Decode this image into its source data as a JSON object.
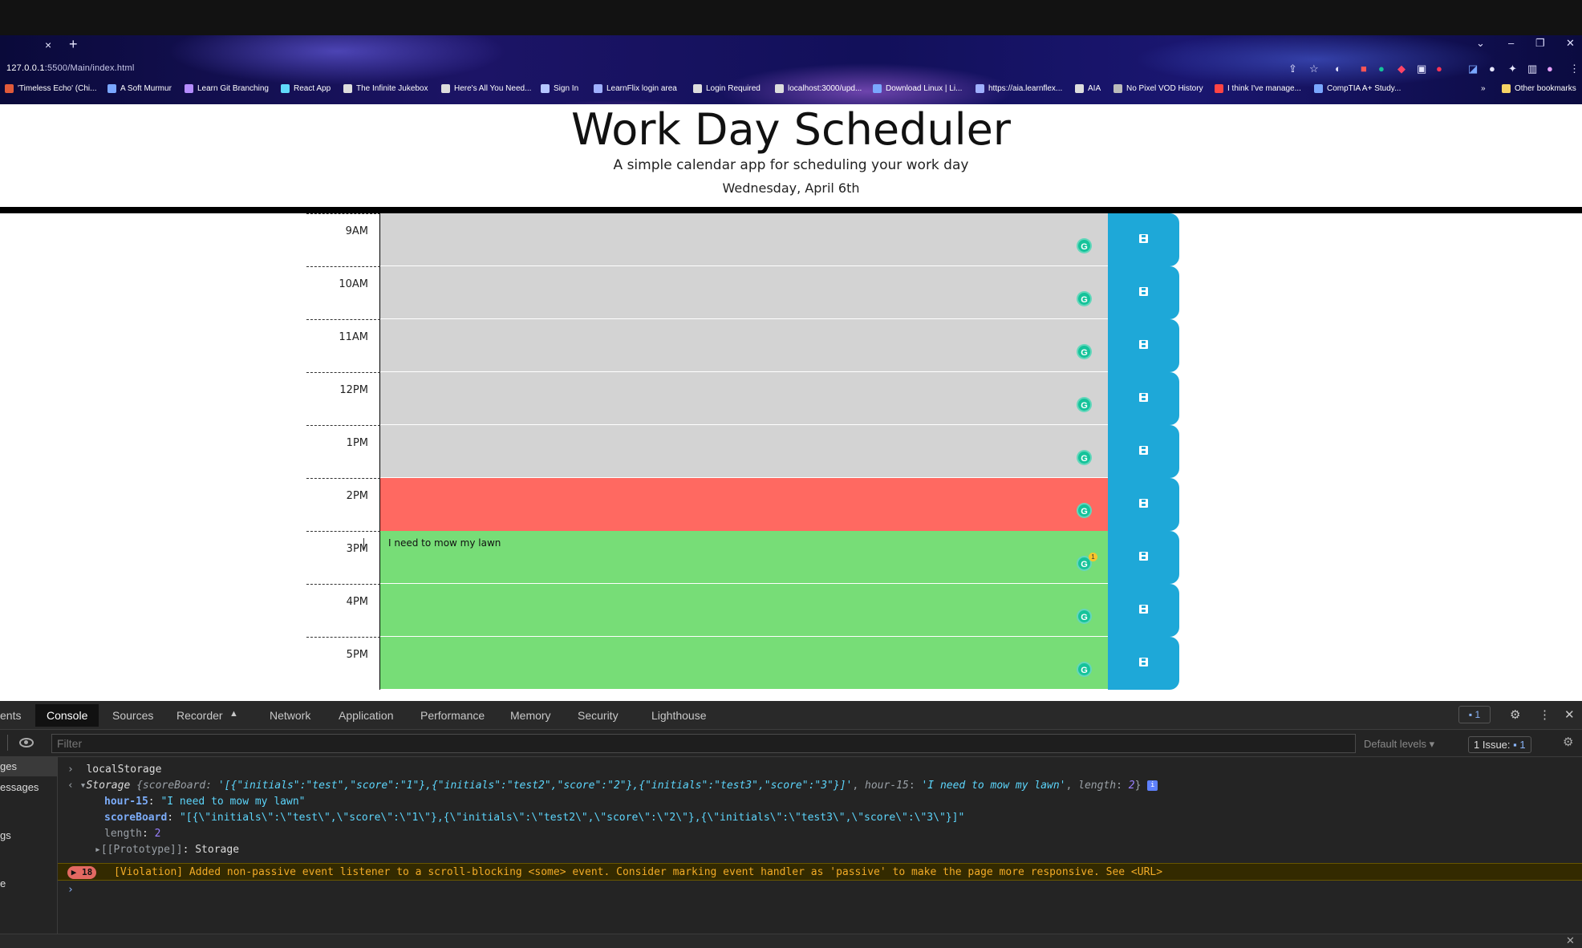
{
  "browser": {
    "tab_close": "×",
    "new_tab": "+",
    "url_host": "127.0.0.1",
    "url_rest": ":5500/Main/index.html",
    "bookmarks": [
      {
        "label": "'Timeless Echo' (Chi...",
        "color": "#e05a3a"
      },
      {
        "label": "A Soft Murmur",
        "color": "#7aa7ff"
      },
      {
        "label": "Learn Git Branching",
        "color": "#b58cff"
      },
      {
        "label": "React App",
        "color": "#61dafb"
      },
      {
        "label": "The Infinite Jukebox",
        "color": "#dddddd"
      },
      {
        "label": "Here's All You Need...",
        "color": "#dddddd"
      },
      {
        "label": "Sign In",
        "color": "#b6c6ff"
      },
      {
        "label": "LearnFlix login area",
        "color": "#9fb0ff"
      },
      {
        "label": "Login Required",
        "color": "#dddddd"
      },
      {
        "label": "localhost:3000/upd...",
        "color": "#dddddd"
      },
      {
        "label": "Download Linux | Li...",
        "color": "#7aa7ff"
      },
      {
        "label": "https://aia.learnflex...",
        "color": "#9fb0ff"
      },
      {
        "label": "AIA",
        "color": "#dddddd"
      },
      {
        "label": "No Pixel VOD History",
        "color": "#bbbbbb"
      },
      {
        "label": "I think I've manage...",
        "color": "#ff4444"
      },
      {
        "label": "CompTIA A+ Study...",
        "color": "#7aa7ff"
      }
    ],
    "bookmarks_more": "»",
    "other_bookmarks": "Other bookmarks"
  },
  "header": {
    "title": "Work Day Scheduler",
    "subtitle": "A simple calendar app for scheduling your work day",
    "date": "Wednesday, April 6th"
  },
  "schedule": [
    {
      "hour": "9AM",
      "text": "",
      "state": "past"
    },
    {
      "hour": "10AM",
      "text": "",
      "state": "past"
    },
    {
      "hour": "11AM",
      "text": "",
      "state": "past"
    },
    {
      "hour": "12PM",
      "text": "",
      "state": "past"
    },
    {
      "hour": "1PM",
      "text": "",
      "state": "past"
    },
    {
      "hour": "2PM",
      "text": "",
      "state": "present"
    },
    {
      "hour": "3PM",
      "text": "I need to mow my lawn",
      "state": "future",
      "badge": "1"
    },
    {
      "hour": "4PM",
      "text": "",
      "state": "future"
    },
    {
      "hour": "5PM",
      "text": "",
      "state": "future"
    }
  ],
  "colors": {
    "past": "#d3d3d3",
    "present": "#ff6961",
    "future": "#77dd77",
    "save": "#1ea8d8"
  },
  "devtools": {
    "tabs": [
      "ents",
      "Console",
      "Sources",
      "Recorder",
      "Network",
      "Application",
      "Performance",
      "Memory",
      "Security",
      "Lighthouse"
    ],
    "active_tab": "Console",
    "messages_badge": "1",
    "filter_placeholder": "Filter",
    "levels": "Default levels",
    "issues": "1 Issue:",
    "issues_count": "1",
    "sidebar": [
      "ges",
      "essages",
      "gs",
      "e"
    ],
    "console": {
      "input": "localStorage",
      "storage_label": "Storage",
      "storage_summary_pre": "{scoreBoard: ",
      "storage_summary_score": "'[{\"initials\":\"test\",\"score\":\"1\"},{\"initials\":\"test2\",\"score\":\"2\"},{\"initials\":\"test3\",\"score\":\"3\"}]'",
      "storage_summary_hour_key": "hour-15",
      "storage_summary_hour_val": "'I need to mow my lawn'",
      "storage_summary_len_key": "length",
      "storage_summary_len_val": "2",
      "hour_key": "hour-15",
      "hour_val": "\"I need to mow my lawn\"",
      "score_key": "scoreBoard",
      "score_val": "\"[{\\\"initials\\\":\\\"test\\\",\\\"score\\\":\\\"1\\\"},{\\\"initials\\\":\\\"test2\\\",\\\"score\\\":\\\"2\\\"},{\\\"initials\\\":\\\"test3\\\",\\\"score\\\":\\\"3\\\"}]\"",
      "length_key": "length",
      "length_val": "2",
      "proto": "[[Prototype]]",
      "proto_val": "Storage",
      "warn_count": "18",
      "warning": "[Violation] Added non-passive event listener to a scroll-blocking <some> event. Consider marking event handler as 'passive' to make the page more responsive. See <URL>"
    }
  }
}
